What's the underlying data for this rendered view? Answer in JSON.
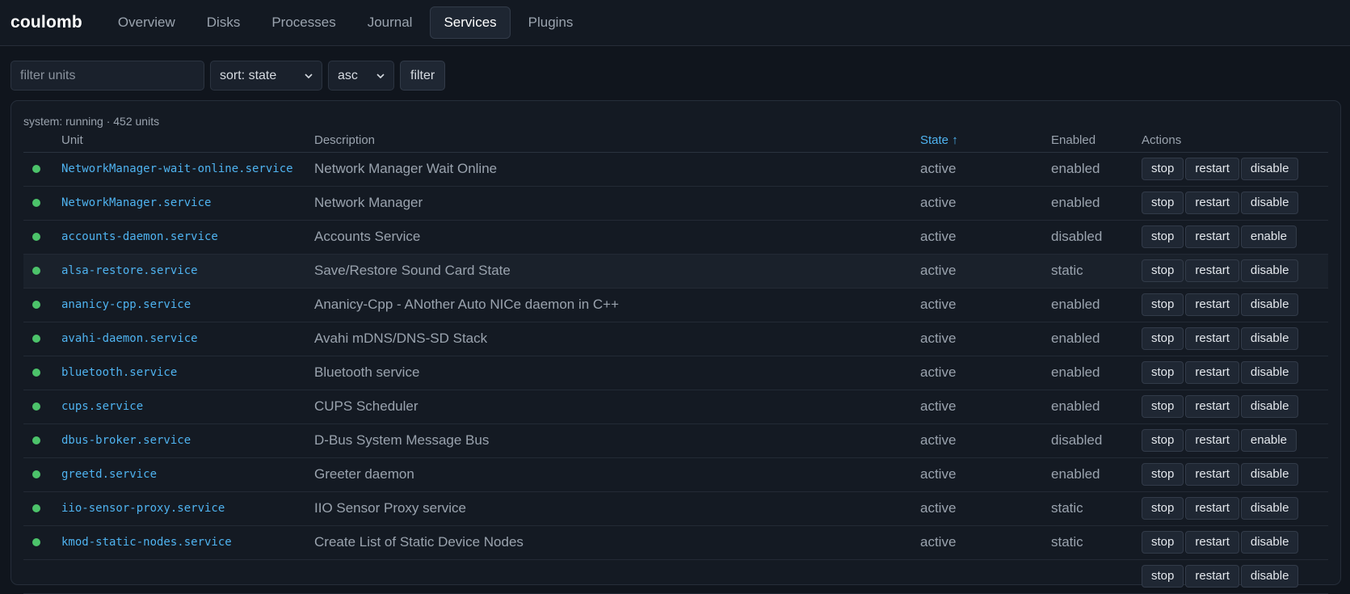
{
  "app": {
    "brand": "coulomb"
  },
  "nav": {
    "tabs": [
      {
        "label": "Overview",
        "active": false
      },
      {
        "label": "Disks",
        "active": false
      },
      {
        "label": "Processes",
        "active": false
      },
      {
        "label": "Journal",
        "active": false
      },
      {
        "label": "Services",
        "active": true
      },
      {
        "label": "Plugins",
        "active": false
      }
    ]
  },
  "toolbar": {
    "filter_placeholder": "filter units",
    "filter_value": "",
    "sort_value": "sort: state",
    "order_value": "asc",
    "filter_button": "filter"
  },
  "summary": "system: running · 452 units",
  "table": {
    "headers": {
      "unit": "Unit",
      "description": "Description",
      "state": "State ↑",
      "enabled": "Enabled",
      "actions": "Actions"
    },
    "rows": [
      {
        "unit": "NetworkManager-wait-online.service",
        "description": "Network Manager Wait Online",
        "state": "active",
        "enabled": "enabled",
        "actions": [
          "stop",
          "restart",
          "disable"
        ]
      },
      {
        "unit": "NetworkManager.service",
        "description": "Network Manager",
        "state": "active",
        "enabled": "enabled",
        "actions": [
          "stop",
          "restart",
          "disable"
        ]
      },
      {
        "unit": "accounts-daemon.service",
        "description": "Accounts Service",
        "state": "active",
        "enabled": "disabled",
        "actions": [
          "stop",
          "restart",
          "enable"
        ]
      },
      {
        "unit": "alsa-restore.service",
        "description": "Save/Restore Sound Card State",
        "state": "active",
        "enabled": "static",
        "actions": [
          "stop",
          "restart",
          "disable"
        ]
      },
      {
        "unit": "ananicy-cpp.service",
        "description": "Ananicy-Cpp - ANother Auto NICe daemon in C++",
        "state": "active",
        "enabled": "enabled",
        "actions": [
          "stop",
          "restart",
          "disable"
        ]
      },
      {
        "unit": "avahi-daemon.service",
        "description": "Avahi mDNS/DNS-SD Stack",
        "state": "active",
        "enabled": "enabled",
        "actions": [
          "stop",
          "restart",
          "disable"
        ]
      },
      {
        "unit": "bluetooth.service",
        "description": "Bluetooth service",
        "state": "active",
        "enabled": "enabled",
        "actions": [
          "stop",
          "restart",
          "disable"
        ]
      },
      {
        "unit": "cups.service",
        "description": "CUPS Scheduler",
        "state": "active",
        "enabled": "enabled",
        "actions": [
          "stop",
          "restart",
          "disable"
        ]
      },
      {
        "unit": "dbus-broker.service",
        "description": "D-Bus System Message Bus",
        "state": "active",
        "enabled": "disabled",
        "actions": [
          "stop",
          "restart",
          "enable"
        ]
      },
      {
        "unit": "greetd.service",
        "description": "Greeter daemon",
        "state": "active",
        "enabled": "enabled",
        "actions": [
          "stop",
          "restart",
          "disable"
        ]
      },
      {
        "unit": "iio-sensor-proxy.service",
        "description": "IIO Sensor Proxy service",
        "state": "active",
        "enabled": "static",
        "actions": [
          "stop",
          "restart",
          "disable"
        ]
      },
      {
        "unit": "kmod-static-nodes.service",
        "description": "Create List of Static Device Nodes",
        "state": "active",
        "enabled": "static",
        "actions": [
          "stop",
          "restart",
          "disable"
        ]
      },
      {
        "unit": "",
        "description": "",
        "state": "",
        "enabled": "",
        "actions": [
          "stop",
          "restart",
          "disable"
        ]
      }
    ]
  },
  "colors": {
    "accent": "#4fb3f0",
    "status_active": "#4cc36a",
    "background": "#10151d"
  }
}
